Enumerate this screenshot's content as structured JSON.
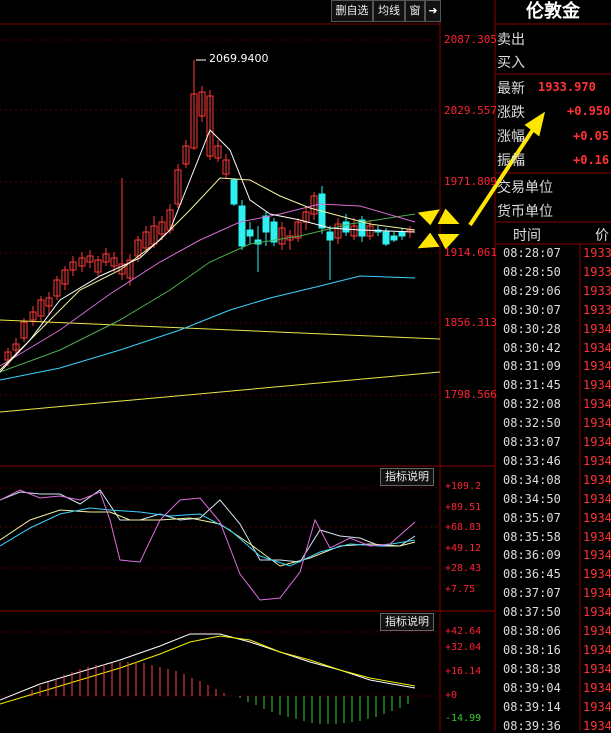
{
  "toolbar": {
    "buttons": [
      "删自选",
      "均线",
      "窗"
    ],
    "exit_icon": "exit-arrow-icon"
  },
  "price_axis": {
    "labels": [
      "2087.305",
      "2029.557",
      "1971.809",
      "1914.061",
      "1856.313",
      "1798.566"
    ]
  },
  "high_marker": "2069.9400",
  "indicator1": {
    "button": "指标说明",
    "labels": [
      "+109.2",
      "+89.51",
      "+68.83",
      "+49.12",
      "+28.43",
      "+7.75"
    ]
  },
  "indicator2": {
    "button": "指标说明",
    "labels": [
      "+42.64",
      "+32.04",
      "+16.14",
      "+0",
      "-14.99"
    ]
  },
  "side": {
    "title": "伦敦金",
    "sell_label": "卖出",
    "buy_label": "买入",
    "latest_label": "最新",
    "latest_value": "1933.970",
    "change_label": "涨跌",
    "change_value": "+0.950",
    "pct_label": "涨幅",
    "pct_value": "+0.05",
    "amp_label": "振幅",
    "amp_value": "+0.16",
    "trade_unit_label": "交易单位",
    "currency_unit_label": "货币单位",
    "col_time": "时间",
    "col_price": "价"
  },
  "ticks": [
    {
      "time": "08:28:07",
      "price": "1933"
    },
    {
      "time": "08:28:50",
      "price": "1933"
    },
    {
      "time": "08:29:06",
      "price": "1933"
    },
    {
      "time": "08:30:07",
      "price": "1933"
    },
    {
      "time": "08:30:28",
      "price": "1934"
    },
    {
      "time": "08:30:42",
      "price": "1934"
    },
    {
      "time": "08:31:09",
      "price": "1934"
    },
    {
      "time": "08:31:45",
      "price": "1934"
    },
    {
      "time": "08:32:08",
      "price": "1934"
    },
    {
      "time": "08:32:50",
      "price": "1934"
    },
    {
      "time": "08:33:07",
      "price": "1934"
    },
    {
      "time": "08:33:46",
      "price": "1934"
    },
    {
      "time": "08:34:08",
      "price": "1934"
    },
    {
      "time": "08:34:50",
      "price": "1934"
    },
    {
      "time": "08:35:07",
      "price": "1934"
    },
    {
      "time": "08:35:58",
      "price": "1934"
    },
    {
      "time": "08:36:09",
      "price": "1934"
    },
    {
      "time": "08:36:45",
      "price": "1934"
    },
    {
      "time": "08:37:07",
      "price": "1934"
    },
    {
      "time": "08:37:50",
      "price": "1934"
    },
    {
      "time": "08:38:06",
      "price": "1934"
    },
    {
      "time": "08:38:16",
      "price": "1934"
    },
    {
      "time": "08:38:38",
      "price": "1934"
    },
    {
      "time": "08:39:04",
      "price": "1934"
    },
    {
      "time": "08:39:14",
      "price": "1934"
    },
    {
      "time": "08:39:36",
      "price": "1934"
    }
  ]
}
